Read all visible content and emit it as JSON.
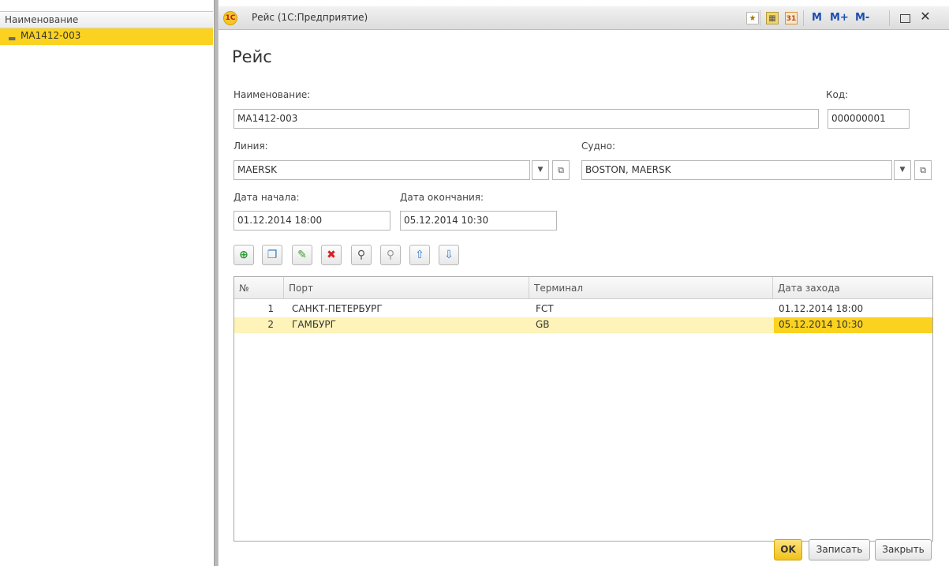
{
  "left_list": {
    "column_header": "Наименование",
    "items": [
      {
        "label": "MA1412-003"
      }
    ]
  },
  "window": {
    "app_logo": "1С",
    "title": "Рейс  (1С:Предприятие)",
    "toolbar": {
      "mem_m": "M",
      "mem_plus": "M+",
      "mem_minus": "M-",
      "calendar_day": "31"
    }
  },
  "form": {
    "title": "Рейс",
    "name_label": "Наименование:",
    "name_value": "MA1412-003",
    "code_label": "Код:",
    "code_value": "000000001",
    "line_label": "Линия:",
    "line_value": "MAERSK",
    "vessel_label": "Судно:",
    "vessel_value": "BOSTON, MAERSK",
    "start_label": "Дата начала:",
    "start_value": "01.12.2014 18:00",
    "end_label": "Дата окончания:",
    "end_value": "05.12.2014 10:30"
  },
  "table": {
    "headers": {
      "num": "№",
      "port": "Порт",
      "terminal": "Терминал",
      "date": "Дата захода"
    },
    "rows": [
      {
        "num": "1",
        "port": "САНКТ-ПЕТЕРБУРГ",
        "terminal": "FCT",
        "date": "01.12.2014 18:00"
      },
      {
        "num": "2",
        "port": "ГАМБУРГ",
        "terminal": "GB",
        "date": "05.12.2014 10:30"
      }
    ]
  },
  "buttons": {
    "ok": "OK",
    "save": "Записать",
    "close": "Закрыть"
  },
  "colors": {
    "selection": "#fad21f",
    "row_highlight": "#fef3b8",
    "accent_blue": "#1b4fb0"
  }
}
